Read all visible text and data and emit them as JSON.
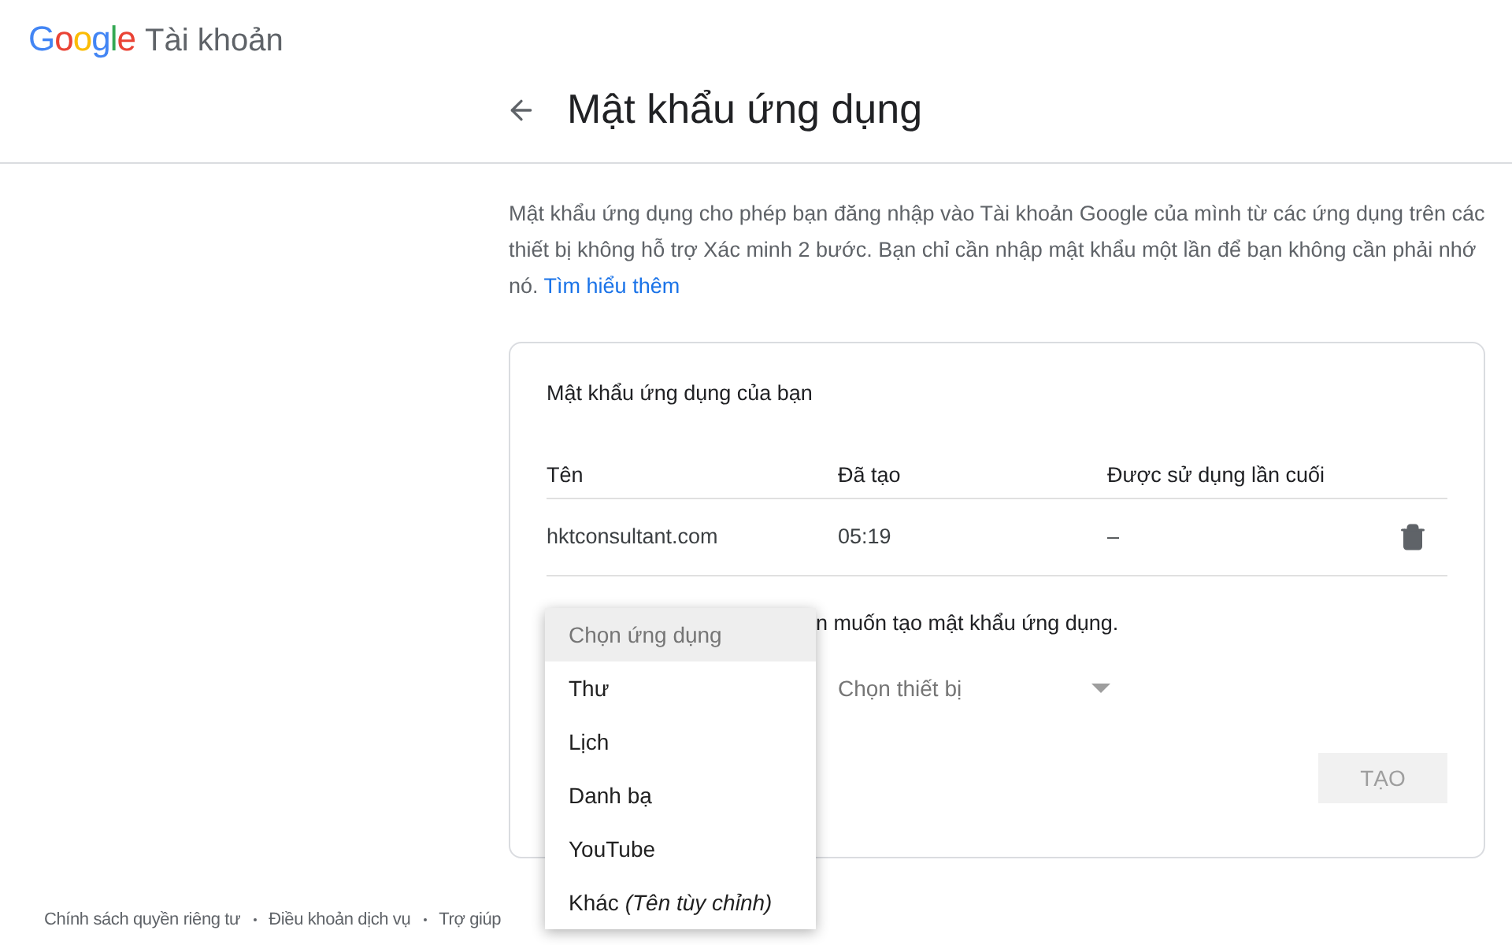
{
  "header": {
    "logo": "Google",
    "product": "Tài khoản"
  },
  "page_title": "Mật khẩu ứng dụng",
  "description": {
    "text": "Mật khẩu ứng dụng cho phép bạn đăng nhập vào Tài khoản Google của mình từ các ứng dụng trên các thiết bị không hỗ trợ Xác minh 2 bước. Bạn chỉ cần nhập mật khẩu một lần để bạn không cần phải nhớ nó.",
    "link": "Tìm hiểu thêm"
  },
  "card": {
    "title": "Mật khẩu ứng dụng của bạn",
    "table": {
      "columns": [
        "Tên",
        "Đã tạo",
        "Được sử dụng lần cuối"
      ],
      "rows": [
        {
          "cells": [
            "hktconsultant.com",
            "05:19",
            "–"
          ]
        }
      ]
    },
    "prompt_visible": "n muốn tạo mật khẩu ứng dụng.",
    "device_select": {
      "placeholder": "Chọn thiết bị"
    },
    "create_button": {
      "label": "TẠO",
      "disabled": true
    }
  },
  "app_menu": [
    {
      "label": "Chọn ứng dụng",
      "selected": true
    },
    {
      "label": "Thư",
      "selected": false
    },
    {
      "label": "Lịch",
      "selected": false
    },
    {
      "label": "Danh bạ",
      "selected": false
    },
    {
      "label": "YouTube",
      "selected": false
    },
    {
      "label": "Khác *(Tên tùy chỉnh)*",
      "selected": false
    }
  ],
  "footer": [
    "Chính sách quyền riêng tư",
    "Điều khoản dịch vụ",
    "Trợ giúp"
  ]
}
